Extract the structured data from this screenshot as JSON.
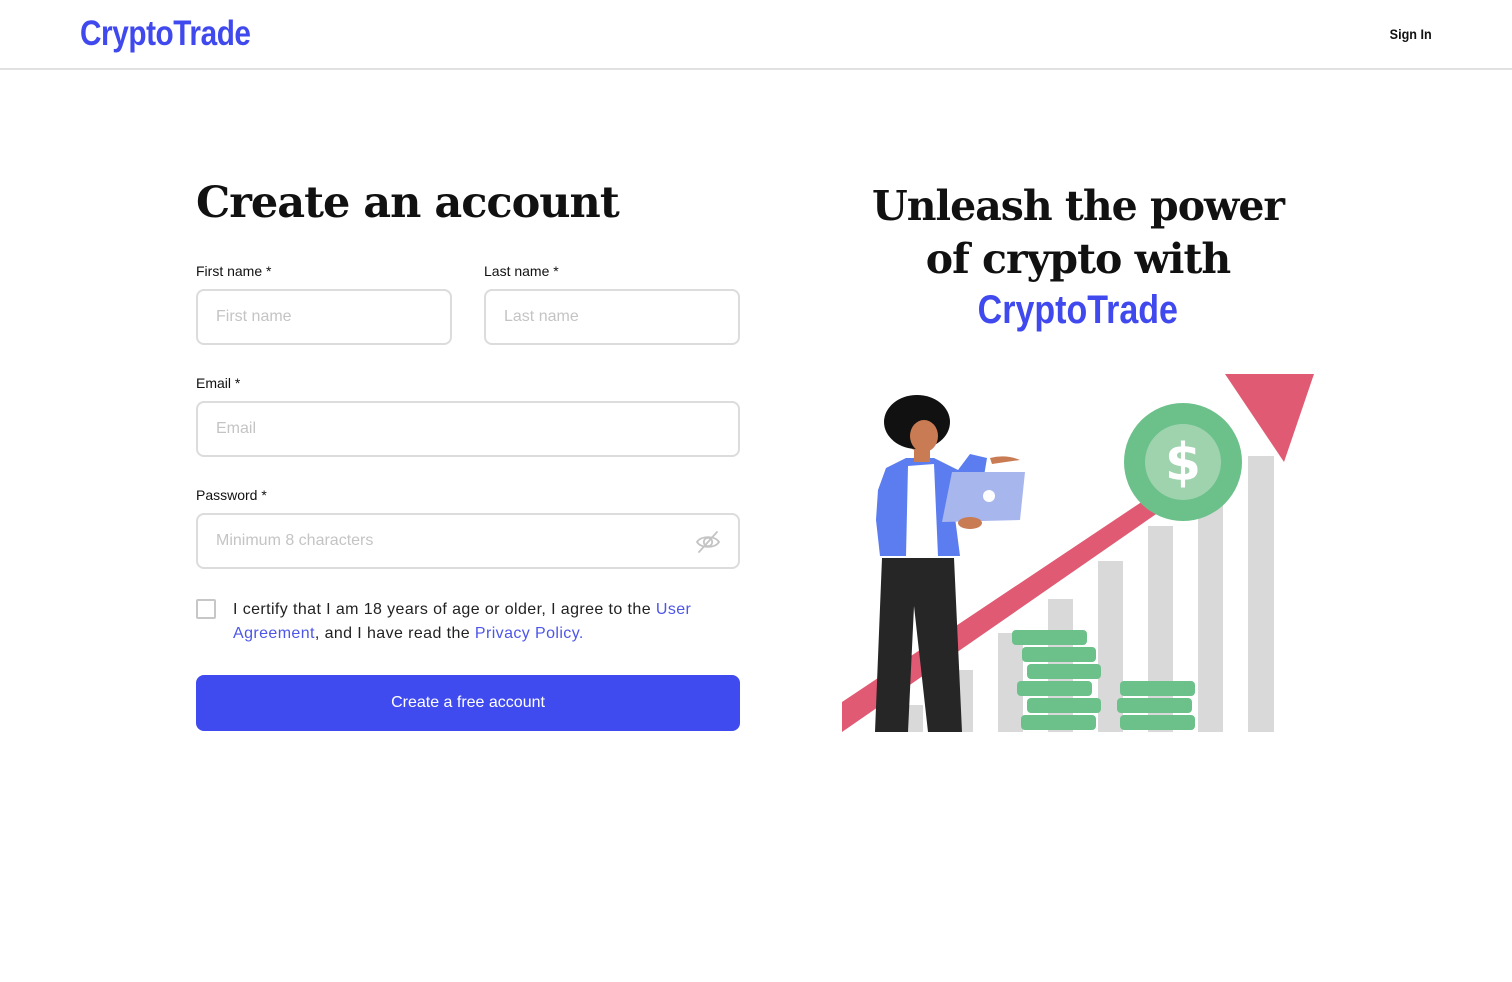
{
  "header": {
    "logo": "CryptoTrade",
    "signin_label": "Sign In"
  },
  "form": {
    "title": "Create an account",
    "first_name": {
      "label": "First name *",
      "placeholder": "First name",
      "value": ""
    },
    "last_name": {
      "label": "Last name *",
      "placeholder": "Last name",
      "value": ""
    },
    "email": {
      "label": "Email *",
      "placeholder": "Email",
      "value": ""
    },
    "password": {
      "label": "Password *",
      "placeholder": "Minimum 8 characters",
      "value": "",
      "toggle_icon": "eye-off-icon"
    },
    "terms": {
      "checked": false,
      "text_1": "I certify that I am 18 years of age or older, I agree to the",
      "link_1": "User Agreement",
      "text_2": ", and I have read the",
      "link_2": "Privacy Policy."
    },
    "submit_label": "Create a free account"
  },
  "promo": {
    "line_1": "Unleash the power",
    "line_2": "of crypto with",
    "brand": "CryptoTrade"
  },
  "colors": {
    "brand": "#4049ee",
    "button": "#404bef",
    "link": "#4d56e8",
    "arrow": "#e05a73",
    "money": "#6cc08a"
  }
}
